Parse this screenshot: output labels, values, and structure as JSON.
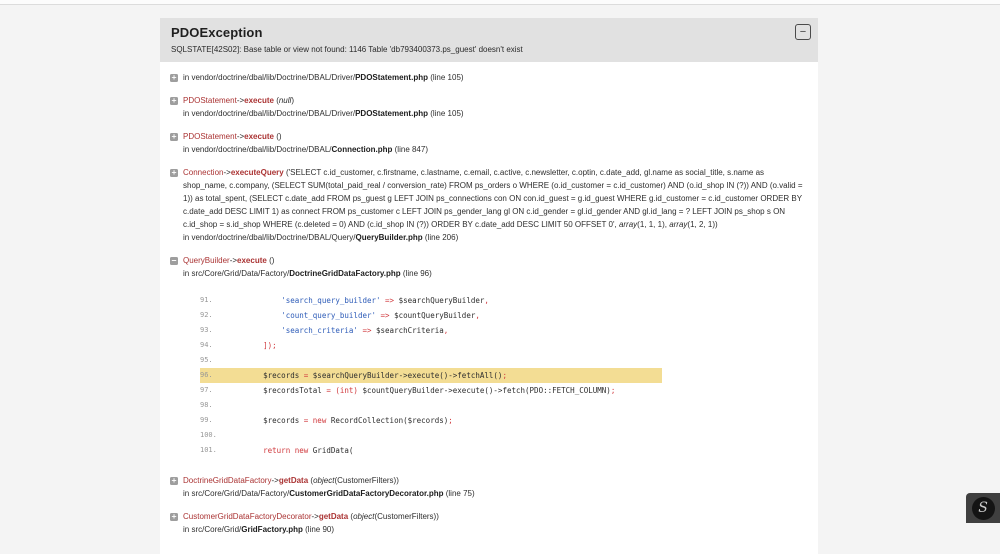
{
  "exception": {
    "title": "PDOException",
    "message": "SQLSTATE[42S02]: Base table or view not found: 1146 Table 'db793400373.ps_guest' doesn't exist"
  },
  "icons": {
    "plus": "+",
    "minus": "−",
    "collapse_header": "−",
    "symfony_logo": "S"
  },
  "colors": {
    "accent_red": "#aa3333",
    "highlight_line": "#f3dd94",
    "code_string": "#2e5cb8",
    "code_keyword": "#d0383c",
    "header_bg": "#e1e1e1"
  },
  "trace_format": {
    "arrow": "->"
  },
  "trace": [
    {
      "toggle": "plus",
      "location": {
        "prefix": "in vendor/doctrine/dbal/lib/Doctrine/DBAL/Driver/",
        "file": "PDOStatement.php",
        "line": "(line 105)"
      }
    },
    {
      "toggle": "plus",
      "call": {
        "class": "PDOStatement",
        "method": "execute",
        "args": [
          {
            "v": "("
          },
          {
            "v": "null",
            "italic": true
          },
          {
            "v": ")"
          }
        ]
      },
      "location": {
        "prefix": "in vendor/doctrine/dbal/lib/Doctrine/DBAL/Driver/",
        "file": "PDOStatement.php",
        "line": "(line 105)"
      }
    },
    {
      "toggle": "plus",
      "call": {
        "class": "PDOStatement",
        "method": "execute",
        "args": [
          {
            "v": "()"
          }
        ]
      },
      "location": {
        "prefix": "in vendor/doctrine/dbal/lib/Doctrine/DBAL/",
        "file": "Connection.php",
        "line": "(line 847)"
      }
    },
    {
      "toggle": "plus",
      "call": {
        "class": "Connection",
        "method": "executeQuery",
        "args": [
          {
            "v": "('SELECT c.id_customer, c.firstname, c.lastname, c.email, c.active, c.newsletter, c.optin, c.date_add, gl.name as social_title, s.name as shop_name, c.company, (SELECT SUM(total_paid_real / conversion_rate) FROM ps_orders o WHERE (o.id_customer = c.id_customer) AND (o.id_shop IN (?)) AND (o.valid = 1)) as total_spent, (SELECT c.date_add FROM ps_guest g LEFT JOIN ps_connections con ON con.id_guest = g.id_guest WHERE g.id_customer = c.id_customer ORDER BY c.date_add DESC LIMIT 1) as connect FROM ps_customer c LEFT JOIN ps_gender_lang gl ON c.id_gender = gl.id_gender AND gl.id_lang = ? LEFT JOIN ps_shop s ON c.id_shop = s.id_shop WHERE (c.deleted = 0) AND (c.id_shop IN (?)) ORDER BY c.date_add DESC LIMIT 50 OFFSET 0', "
          },
          {
            "v": "array",
            "italic": true
          },
          {
            "v": "(1, 1, 1), "
          },
          {
            "v": "array",
            "italic": true
          },
          {
            "v": "(1, 2, 1))"
          }
        ]
      },
      "location": {
        "prefix": "in vendor/doctrine/dbal/lib/Doctrine/DBAL/Query/",
        "file": "QueryBuilder.php",
        "line": "(line 206)"
      }
    },
    {
      "toggle": "minus",
      "call": {
        "class": "QueryBuilder",
        "method": "execute",
        "args": [
          {
            "v": "()"
          }
        ]
      },
      "location": {
        "prefix": "in src/Core/Grid/Data/Factory/",
        "file": "DoctrineGridDataFactory.php",
        "line": "(line 96)"
      },
      "code": [
        {
          "n": "91.",
          "tokens": [
            {
              "c": "d",
              "v": "            "
            },
            {
              "c": "s",
              "v": "'search_query_builder'"
            },
            {
              "c": "k",
              "v": " => "
            },
            {
              "c": "d",
              "v": "$searchQueryBuilder"
            },
            {
              "c": "k",
              "v": ","
            }
          ]
        },
        {
          "n": "92.",
          "tokens": [
            {
              "c": "d",
              "v": "            "
            },
            {
              "c": "s",
              "v": "'count_query_builder'"
            },
            {
              "c": "k",
              "v": " => "
            },
            {
              "c": "d",
              "v": "$countQueryBuilder"
            },
            {
              "c": "k",
              "v": ","
            }
          ]
        },
        {
          "n": "93.",
          "tokens": [
            {
              "c": "d",
              "v": "            "
            },
            {
              "c": "s",
              "v": "'search_criteria'"
            },
            {
              "c": "k",
              "v": " => "
            },
            {
              "c": "d",
              "v": "$searchCriteria"
            },
            {
              "c": "k",
              "v": ","
            }
          ]
        },
        {
          "n": "94.",
          "tokens": [
            {
              "c": "d",
              "v": "        "
            },
            {
              "c": "k",
              "v": "]);"
            }
          ]
        },
        {
          "n": "95.",
          "tokens": []
        },
        {
          "n": "96.",
          "hl": true,
          "tokens": [
            {
              "c": "d",
              "v": "        $records "
            },
            {
              "c": "k",
              "v": "= "
            },
            {
              "c": "d",
              "v": "$searchQueryBuilder->execute()->fetchAll()"
            },
            {
              "c": "k",
              "v": ";"
            }
          ]
        },
        {
          "n": "97.",
          "tokens": [
            {
              "c": "d",
              "v": "        $recordsTotal "
            },
            {
              "c": "k",
              "v": "= (int)"
            },
            {
              "c": "d",
              "v": " $countQueryBuilder->execute()->fetch(PDO::FETCH_COLUMN)"
            },
            {
              "c": "k",
              "v": ";"
            }
          ]
        },
        {
          "n": "98.",
          "tokens": []
        },
        {
          "n": "99.",
          "tokens": [
            {
              "c": "d",
              "v": "        $records "
            },
            {
              "c": "k",
              "v": "= new "
            },
            {
              "c": "d",
              "v": "RecordCollection($records)"
            },
            {
              "c": "k",
              "v": ";"
            }
          ]
        },
        {
          "n": "100.",
          "tokens": []
        },
        {
          "n": "101.",
          "tokens": [
            {
              "c": "d",
              "v": "        "
            },
            {
              "c": "k",
              "v": "return new "
            },
            {
              "c": "d",
              "v": "GridData("
            }
          ]
        }
      ]
    },
    {
      "toggle": "plus",
      "call": {
        "class": "DoctrineGridDataFactory",
        "method": "getData",
        "args": [
          {
            "v": "("
          },
          {
            "v": "object",
            "italic": true
          },
          {
            "v": "(CustomerFilters))"
          }
        ]
      },
      "location": {
        "prefix": "in src/Core/Grid/Data/Factory/",
        "file": "CustomerGridDataFactoryDecorator.php",
        "line": "(line 75)"
      }
    },
    {
      "toggle": "plus",
      "call": {
        "class": "CustomerGridDataFactoryDecorator",
        "method": "getData",
        "args": [
          {
            "v": "("
          },
          {
            "v": "object",
            "italic": true
          },
          {
            "v": "(CustomerFilters))"
          }
        ]
      },
      "location": {
        "prefix": "in src/Core/Grid/",
        "file": "GridFactory.php",
        "line": "(line 90)"
      }
    }
  ]
}
